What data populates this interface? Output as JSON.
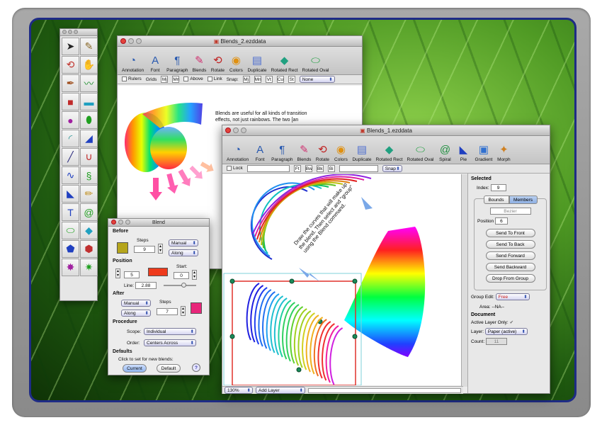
{
  "palette": {
    "tools": [
      "arrow-tool-icon",
      "text-edit-tool-icon",
      "rotate-tool-icon",
      "hand-tool-icon",
      "pen-tool-icon",
      "freehand-tool-icon",
      "rectangle-tool-icon",
      "rounded-rect-tool-icon",
      "oval-tool-icon",
      "ellipse-tool-icon",
      "arc-tool-icon",
      "triangle-tool-icon",
      "line-tool-icon",
      "u-shape-tool-icon",
      "bezier-tool-icon",
      "spiral-curve-tool-icon",
      "polygon-tool-icon",
      "pencil-tool-icon",
      "text-tool-icon",
      "spiral-tool-icon",
      "rotated-oval-tool-icon",
      "rotated-rect-tool-icon",
      "pentagon-tool-icon",
      "hexagon-tool-icon",
      "star-tool-icon",
      "burst-tool-icon"
    ]
  },
  "win2": {
    "title": "Blends_2.ezddata",
    "toolbar": [
      "Annotation",
      "Font",
      "Paragraph",
      "Blends",
      "Rotate",
      "Colors",
      "Duplicate",
      "Rotated Rect",
      "Rotated Oval"
    ],
    "opts": {
      "rulers": "Rulers",
      "grids": "Grids",
      "above": "Above",
      "link": "Link",
      "snap": "Snap:",
      "snap_pop": "None",
      "grid_btns": [
        "Mj",
        "Mn"
      ],
      "snap_btns": [
        "Mj",
        "Mn",
        "Vt",
        "Cu",
        "St"
      ]
    },
    "text": "Blends are useful for all kinds of transition effects, not just rainbows. The two [an"
  },
  "win1": {
    "title": "Blends_1.ezddata",
    "toolbar": [
      "Annotation",
      "Font",
      "Paragraph",
      "Blends",
      "Rotate",
      "Colors",
      "Duplicate",
      "Rotated Rect",
      "Rotated Oval",
      "Spiral",
      "Pie",
      "Gradient",
      "Morph"
    ],
    "opts": {
      "lock": "Lock",
      "snap": "Snap",
      "fill_btns": [
        "Ft",
        "Bw",
        "Bk",
        "Bi"
      ]
    },
    "annotation": "Draw the curves that will make up the blend. Then select and \"group\" using the Blend command.",
    "zoom": "130%",
    "layer": "Add Layer"
  },
  "inspector": {
    "selected": "Selected",
    "index_label": "Index:",
    "index": "9",
    "tabs": [
      "Bounds",
      "Members"
    ],
    "kind": "Bezier",
    "position_label": "Position",
    "position": "6",
    "buttons": [
      "Send To Front",
      "Send To Back",
      "Send Forward",
      "Send Backward",
      "Drop From Group"
    ],
    "group_edit_label": "Group Edit:",
    "group_edit": "Free",
    "area_label": "Area:",
    "area": "--NA--",
    "document": "Document",
    "active_layer_only": "Active Layer Only:",
    "layer_label": "Layer:",
    "layer": "Paper (active)",
    "count_label": "Count:",
    "count": "11"
  },
  "blend": {
    "title": "Blend",
    "before": "Before",
    "steps_label": "Steps",
    "steps_before": "9",
    "manual": "Manual",
    "along": "Along",
    "position": "Position",
    "pos_val": "5",
    "start_label": "Start:",
    "start": "0",
    "line_label": "Line:",
    "line": "2.88",
    "after": "After",
    "steps_after": "7",
    "procedure": "Procedure",
    "scope_label": "Scope:",
    "scope": "Individual",
    "order_label": "Order:",
    "order": "Centers Across",
    "defaults": "Defaults",
    "click_to_set": "Click to set  for  new blends:",
    "current": "Current",
    "default": "Default",
    "help": "?",
    "colors": {
      "before": "#b5a51c",
      "position": "#ee3a1c",
      "after": "#e8267a"
    }
  }
}
